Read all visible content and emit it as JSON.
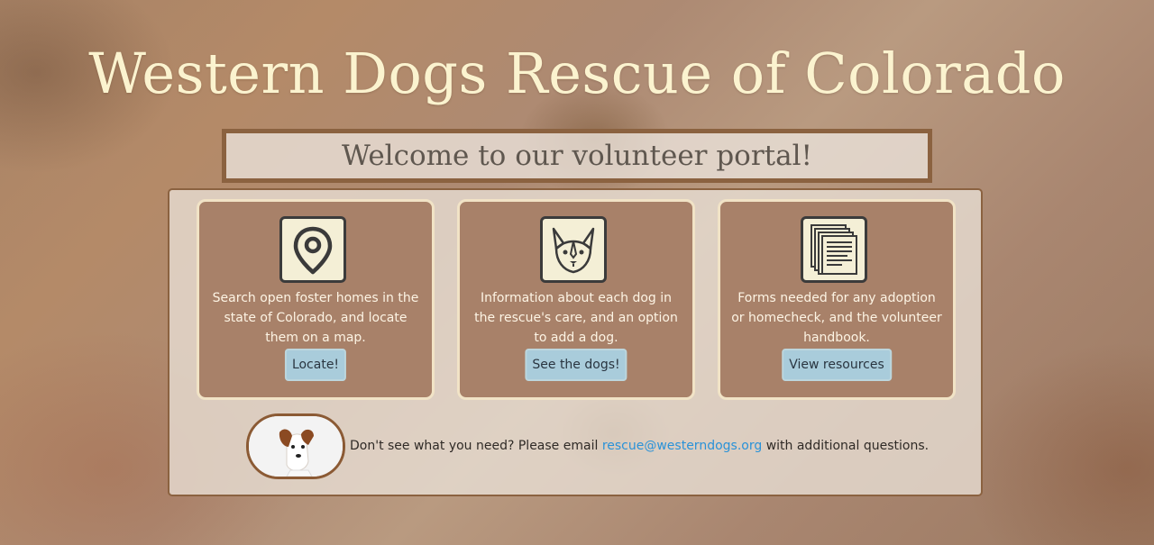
{
  "site": {
    "title": "Western Dogs Rescue of Colorado",
    "welcome": "Welcome to our volunteer portal!"
  },
  "cards": [
    {
      "icon": "map-pin-icon",
      "text": "Search open foster homes in the state of Colorado, and locate them on a map.",
      "button": "Locate!"
    },
    {
      "icon": "dog-face-icon",
      "text": "Information about each dog in the rescue's care, and an option to add a dog.",
      "button": "See the dogs!"
    },
    {
      "icon": "documents-icon",
      "text": "Forms needed for any adoption or homecheck, and the volunteer handbook.",
      "button": "View resources"
    }
  ],
  "footer": {
    "prefix": "Don't see what you need? Please email ",
    "email": "rescue@westerndogs.org",
    "suffix": " with additional questions."
  },
  "colors": {
    "title": "#fbf3cf",
    "card": "#a88169",
    "button": "#a9ccdb",
    "border": "#8b6240",
    "link": "#2a92d8"
  }
}
